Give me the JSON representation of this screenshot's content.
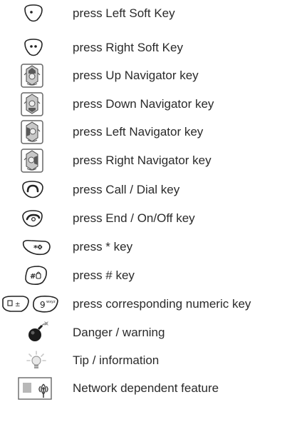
{
  "legend": {
    "items": [
      {
        "icon": "left-soft-key-icon",
        "text": "press Left Soft Key"
      },
      {
        "icon": "right-soft-key-icon",
        "text": "press Right Soft Key"
      },
      {
        "icon": "up-navigator-key-icon",
        "text": "press Up Navigator key"
      },
      {
        "icon": "down-navigator-key-icon",
        "text": "press Down Navigator key"
      },
      {
        "icon": "left-navigator-key-icon",
        "text": "press Left Navigator key"
      },
      {
        "icon": "right-navigator-key-icon",
        "text": "press Right Navigator key"
      },
      {
        "icon": "call-dial-key-icon",
        "text": "press Call / Dial key"
      },
      {
        "icon": "end-on-off-key-icon",
        "text": "press End / On/Off key"
      },
      {
        "icon": "star-key-icon",
        "text": "press * key"
      },
      {
        "icon": "hash-key-icon",
        "text": "press # key"
      },
      {
        "icon": "numeric-key-icon",
        "text": "press corresponding numeric key"
      },
      {
        "icon": "danger-bomb-icon",
        "text": "Danger / warning"
      },
      {
        "icon": "tip-lightbulb-icon",
        "text": "Tip / information"
      },
      {
        "icon": "network-antenna-icon",
        "text": "Network dependent feature"
      }
    ]
  }
}
